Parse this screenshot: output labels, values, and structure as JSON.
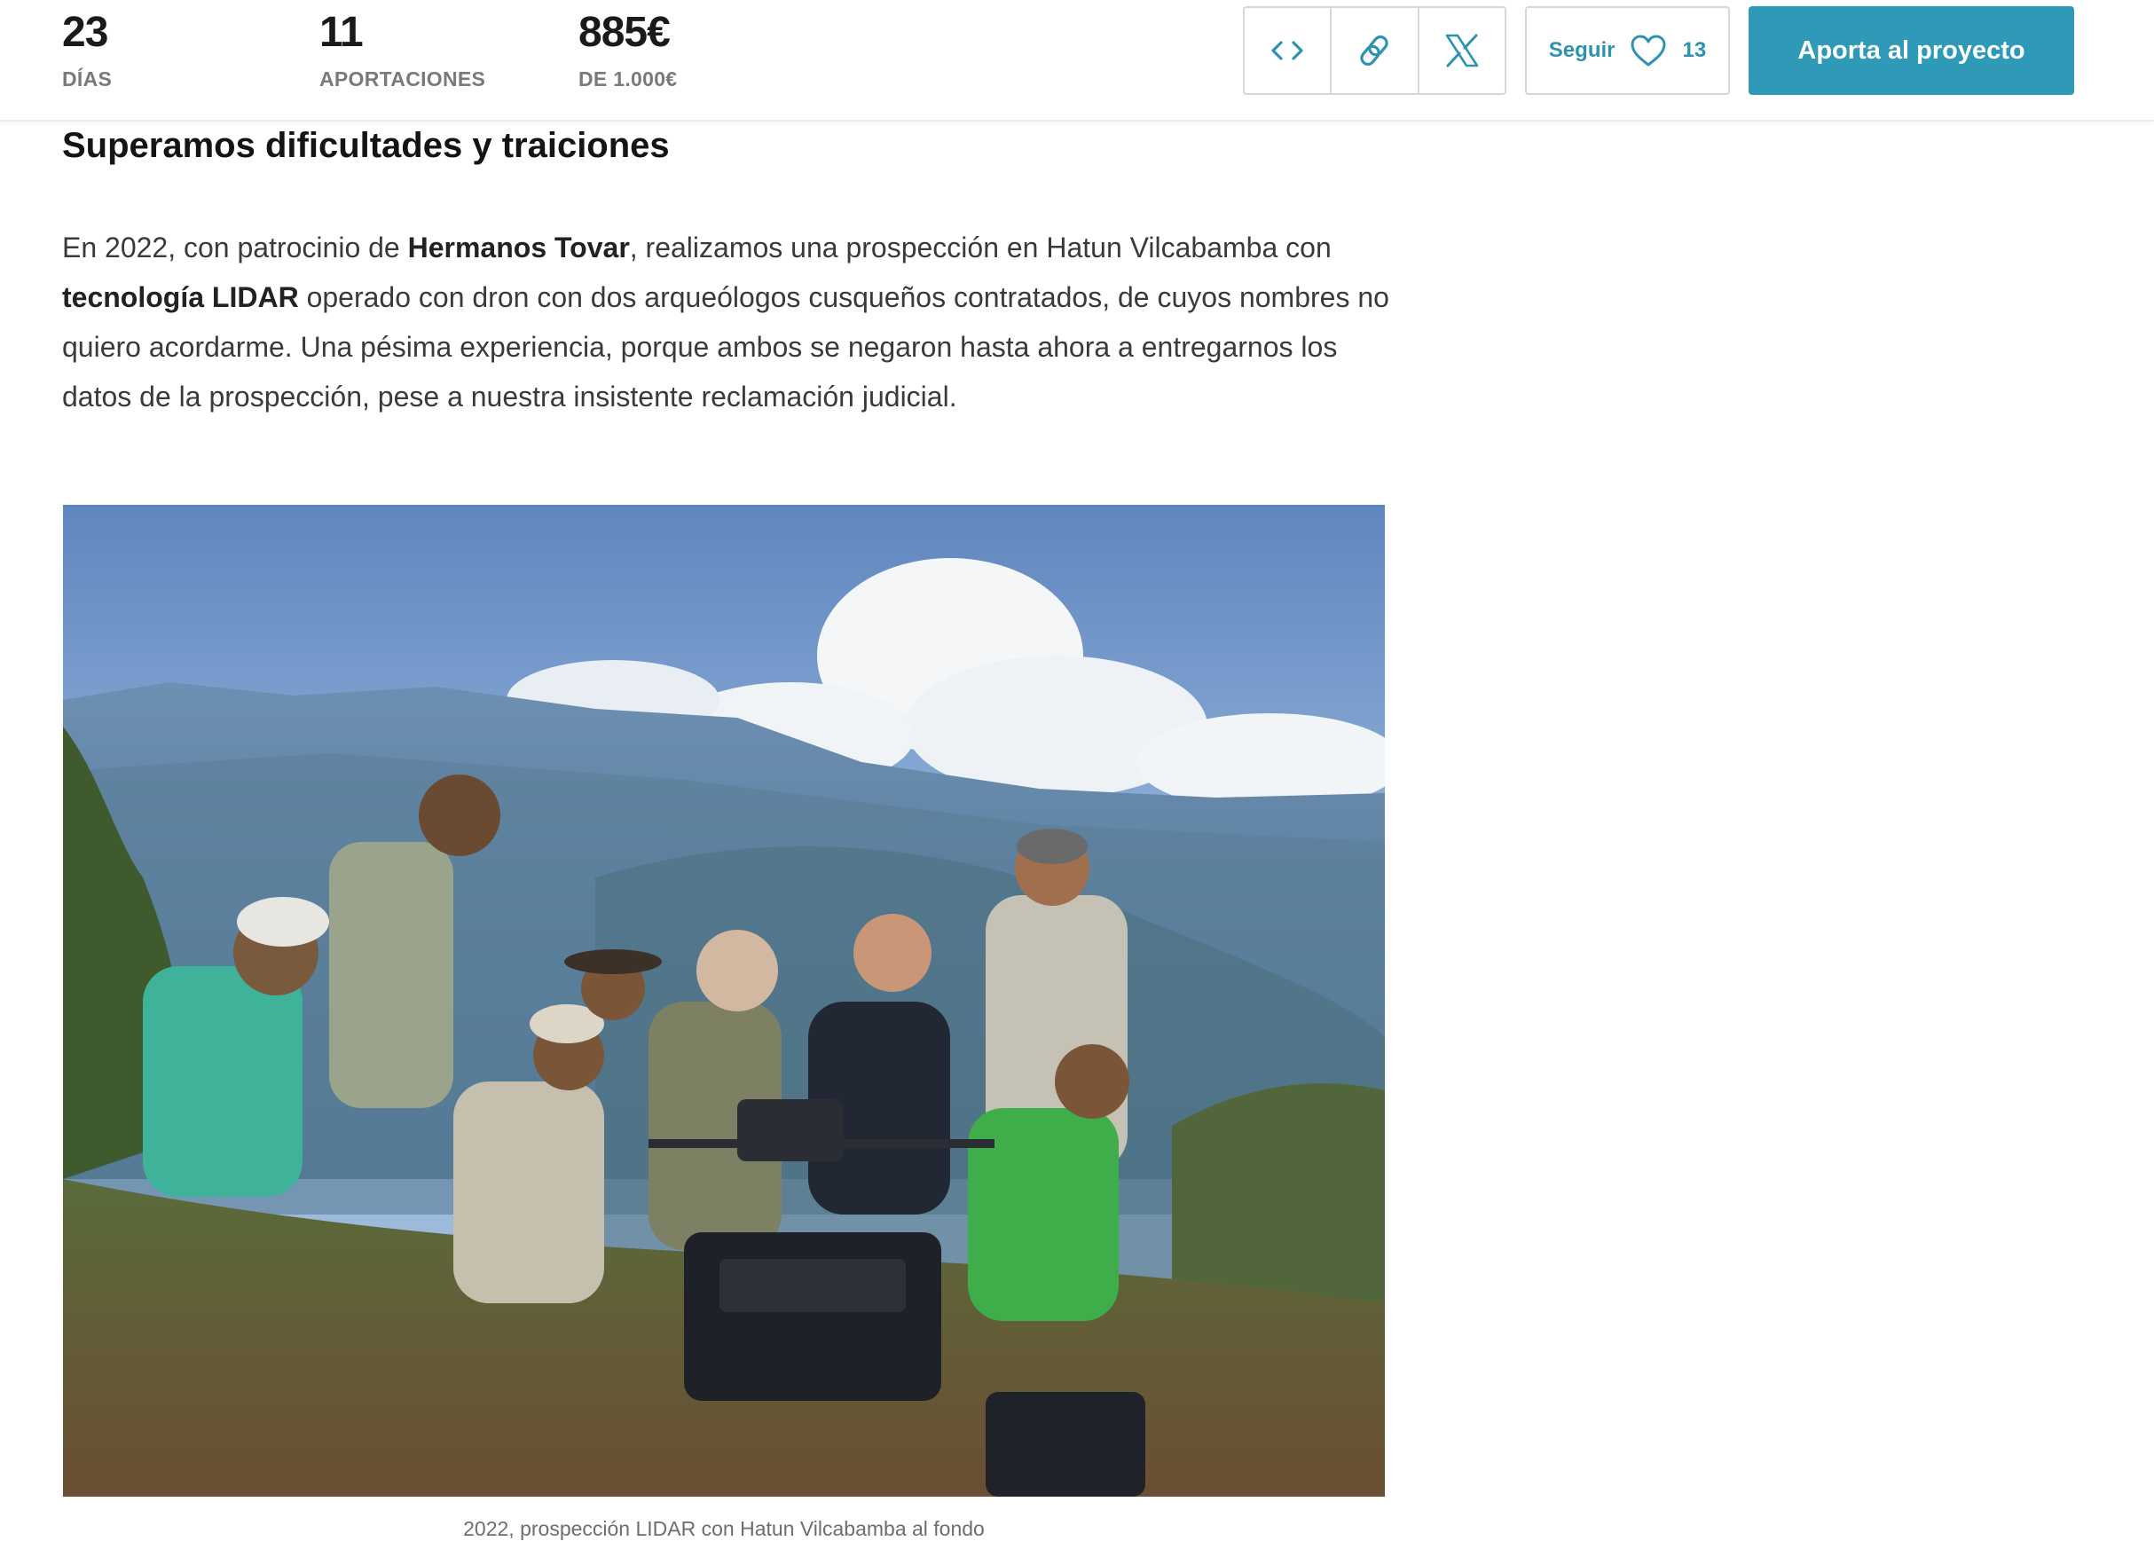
{
  "stats": {
    "days": {
      "value": "23",
      "label": "DÍAS"
    },
    "contributions": {
      "value": "11",
      "label": "APORTACIONES"
    },
    "amount": {
      "value": "885€",
      "label": "DE 1.000€"
    }
  },
  "share": {
    "embed_icon": "code-icon",
    "link_icon": "link-icon",
    "x_icon": "x-icon"
  },
  "follow": {
    "label": "Seguir",
    "count": "13",
    "icon": "heart-icon"
  },
  "cta": {
    "label": "Aporta al proyecto"
  },
  "colors": {
    "accent": "#2f9ab8",
    "accent_text": "#2f93b0"
  },
  "article": {
    "heading": "Superamos dificultades y traiciones",
    "para": {
      "t1": "En 2022, con patrocinio de ",
      "b1": "Hermanos Tovar",
      "t2": ", realizamos una prospección en Hatun Vilcabamba con ",
      "b2": "tecnología LIDAR",
      "t3": " operado con dron con dos arqueólogos cusqueños contratados, de cuyos nombres no quiero acordarme. Una pésima experiencia, porque ambos se negaron hasta ahora a entregarnos los datos de la prospección, pese a nuestra insistente reclamación judicial."
    },
    "caption": "2022, prospección LIDAR con Hatun Vilcabamba al fondo"
  }
}
